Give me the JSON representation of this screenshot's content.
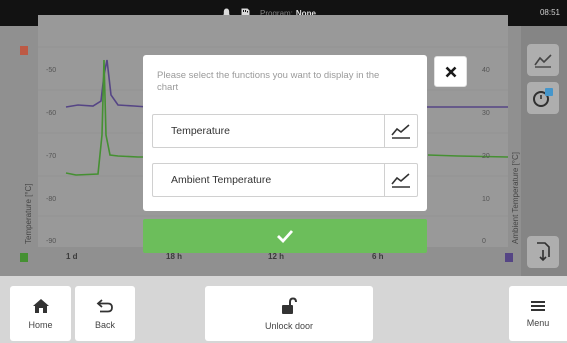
{
  "status": {
    "program_label": "Program:",
    "program_value": "None",
    "time": "08:51"
  },
  "chart": {
    "left_axis_title": "Temperature [°C]",
    "right_axis_title": "Ambient Temperature [°C]",
    "left_ticks": [
      "-50",
      "-60",
      "-70",
      "-80",
      "-90"
    ],
    "right_ticks": [
      "40",
      "30",
      "20",
      "10",
      "0"
    ],
    "x_ticks": [
      "1 d",
      "18 h",
      "12 h",
      "6 h"
    ],
    "colors": {
      "series_green": "#4a9a36",
      "series_purple": "#5b4a8e",
      "left_marker": "#d9604a",
      "right_marker": "#6a5a9a"
    }
  },
  "modal": {
    "prompt": "Please select the functions you want to display in the chart",
    "functions": [
      {
        "label": "Temperature",
        "icon": "chart-line-icon"
      },
      {
        "label": "Ambient Temperature",
        "icon": "chart-line-icon"
      }
    ],
    "close_icon": "close-icon",
    "confirm_icon": "check-icon",
    "accent": "#6cbe5b"
  },
  "bottom": {
    "home_label": "Home",
    "back_label": "Back",
    "unlock_label": "Unlock door",
    "menu_label": "Menu"
  }
}
